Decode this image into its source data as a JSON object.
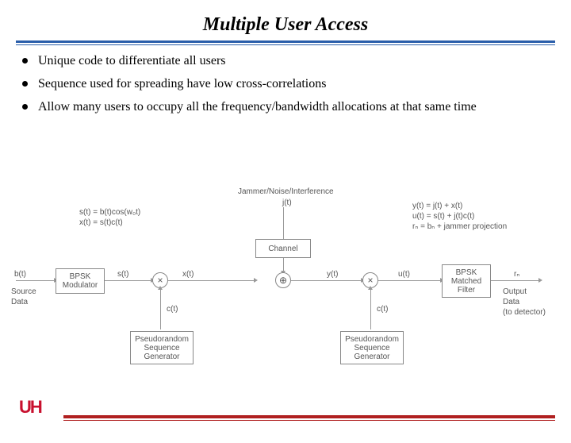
{
  "slide": {
    "title": "Multiple User Access",
    "bullets": [
      "Unique code to differentiate all users",
      "Sequence used for spreading have low cross-correlations",
      "Allow many users to occupy all the frequency/bandwidth allocations at that same time"
    ]
  },
  "diagram": {
    "top_label": "Jammer/Noise/Interference",
    "jitter_sig": "j(t)",
    "eq_left": [
      "s(t) = b(t)cos(w₀t)",
      "x(t) = s(t)c(t)"
    ],
    "eq_right": [
      "y(t) = j(t) + x(t)",
      "u(t) = s(t) + j(t)c(t)",
      "rₙ = bₙ + jammer projection"
    ],
    "sig_bt": "b(t)",
    "sig_st": "s(t)",
    "sig_xt": "x(t)",
    "sig_yt": "y(t)",
    "sig_ut": "u(t)",
    "sig_rn": "rₙ",
    "sig_ct_l": "c(t)",
    "sig_ct_r": "c(t)",
    "src": "Source\nData",
    "out": "Output\nData\n(to detector)",
    "box_bpsk_mod": "BPSK\nModulator",
    "box_channel": "Channel",
    "box_bpsk_mf": "BPSK\nMatched\nFilter",
    "box_psg_l": "Pseudorandom\nSequence\nGenerator",
    "box_psg_r": "Pseudorandom\nSequence\nGenerator"
  },
  "brand": {
    "logo_text": "UH",
    "accent": "#c8102e"
  }
}
